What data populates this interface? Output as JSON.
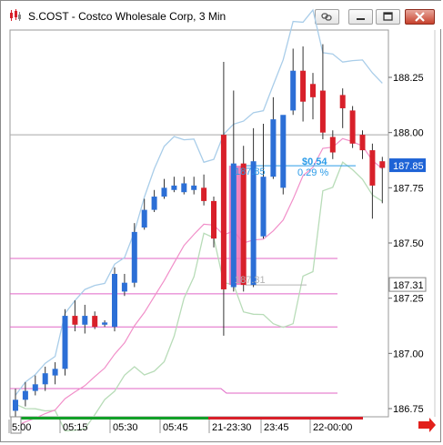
{
  "window": {
    "title": "S.COST - Costco Wholesale Corp, 3 Min"
  },
  "icons": {
    "app": "candlestick-app-icon",
    "link": "chain-link-icon",
    "minimize": "minimize-icon",
    "maximize": "maximize-icon",
    "close": "close-icon",
    "scroll": "scroll-right-arrow-icon"
  },
  "colors": {
    "up_candle": "#2c6fd6",
    "down_candle": "#d8202a",
    "upper_band": "#a9cde9",
    "lower_band": "#b8dcb8",
    "pink_line": "#f18fc9",
    "magenta_level": "#e066c6",
    "highlight": "#ee6fb2",
    "measure_text": "#2a9be8",
    "last_price_bg": "#1e63d6",
    "arrow": "#e2201b"
  },
  "chart_data": {
    "type": "candlestick",
    "symbol": "S.COST",
    "interval": "3 Min",
    "y_ticks": [
      "188.25",
      "188.00",
      "187.75",
      "187.50",
      "187.25",
      "187.00",
      "186.75"
    ],
    "y_tick_values": [
      188.25,
      188.0,
      187.75,
      187.5,
      187.25,
      187.0,
      186.75
    ],
    "x_ticks": [
      "5:00",
      "05:15",
      "05:30",
      "05:45",
      "21-23:30",
      "23:45",
      "22-00:00"
    ],
    "ylim": [
      186.69,
      188.45
    ],
    "price_labels": [
      {
        "text": "187.85",
        "value": 187.85,
        "style": "last"
      },
      {
        "text": "187.31",
        "value": 187.31,
        "style": "mark"
      }
    ],
    "measure": {
      "start_price": "187.31",
      "end_price": "187.85",
      "change": "$0.54",
      "pct": "0.29 %"
    },
    "reference_line": 187.99,
    "horizontal_levels": [
      187.43,
      187.27,
      187.12,
      186.82
    ],
    "candles": [
      {
        "o": 186.74,
        "h": 186.84,
        "l": 186.69,
        "c": 186.79
      },
      {
        "o": 186.79,
        "h": 186.87,
        "l": 186.76,
        "c": 186.83
      },
      {
        "o": 186.83,
        "h": 186.9,
        "l": 186.81,
        "c": 186.86
      },
      {
        "o": 186.86,
        "h": 186.94,
        "l": 186.83,
        "c": 186.91
      },
      {
        "o": 186.9,
        "h": 186.96,
        "l": 186.86,
        "c": 186.93
      },
      {
        "o": 186.93,
        "h": 187.2,
        "l": 186.9,
        "c": 187.17
      },
      {
        "o": 187.17,
        "h": 187.24,
        "l": 187.1,
        "c": 187.13
      },
      {
        "o": 187.13,
        "h": 187.22,
        "l": 187.09,
        "c": 187.17
      },
      {
        "o": 187.17,
        "h": 187.19,
        "l": 187.11,
        "c": 187.12
      },
      {
        "o": 187.13,
        "h": 187.15,
        "l": 187.12,
        "c": 187.14
      },
      {
        "o": 187.12,
        "h": 187.39,
        "l": 187.1,
        "c": 187.36
      },
      {
        "o": 187.28,
        "h": 187.36,
        "l": 187.26,
        "c": 187.32
      },
      {
        "o": 187.32,
        "h": 187.59,
        "l": 187.3,
        "c": 187.55
      },
      {
        "o": 187.57,
        "h": 187.7,
        "l": 187.56,
        "c": 187.65
      },
      {
        "o": 187.65,
        "h": 187.74,
        "l": 187.64,
        "c": 187.71
      },
      {
        "o": 187.71,
        "h": 187.79,
        "l": 187.7,
        "c": 187.75
      },
      {
        "o": 187.74,
        "h": 187.8,
        "l": 187.73,
        "c": 187.76
      },
      {
        "o": 187.73,
        "h": 187.8,
        "l": 187.72,
        "c": 187.77
      },
      {
        "o": 187.74,
        "h": 187.8,
        "l": 187.72,
        "c": 187.76
      },
      {
        "o": 187.75,
        "h": 187.81,
        "l": 187.67,
        "c": 187.69
      },
      {
        "o": 187.69,
        "h": 187.71,
        "l": 187.48,
        "c": 187.52
      },
      {
        "o": 187.99,
        "h": 188.32,
        "l": 187.08,
        "c": 187.29
      },
      {
        "o": 187.3,
        "h": 188.19,
        "l": 187.28,
        "c": 187.86
      },
      {
        "o": 187.86,
        "h": 187.94,
        "l": 187.28,
        "c": 187.31
      },
      {
        "o": 187.31,
        "h": 188.02,
        "l": 187.3,
        "c": 187.87
      },
      {
        "o": 187.53,
        "h": 188.04,
        "l": 187.52,
        "c": 187.8
      },
      {
        "o": 187.8,
        "h": 188.16,
        "l": 187.79,
        "c": 188.06
      },
      {
        "o": 187.75,
        "h": 188.04,
        "l": 187.72,
        "c": 188.08
      },
      {
        "o": 188.1,
        "h": 188.38,
        "l": 188.08,
        "c": 188.28
      },
      {
        "o": 188.28,
        "h": 188.39,
        "l": 188.05,
        "c": 188.14
      },
      {
        "o": 188.22,
        "h": 188.27,
        "l": 188.06,
        "c": 188.16
      },
      {
        "o": 188.19,
        "h": 188.4,
        "l": 187.97,
        "c": 188.0
      },
      {
        "o": 187.98,
        "h": 188.01,
        "l": 187.88,
        "c": 187.91
      },
      {
        "o": 188.17,
        "h": 188.2,
        "l": 188.02,
        "c": 188.11
      },
      {
        "o": 188.1,
        "h": 188.12,
        "l": 187.93,
        "c": 187.95
      },
      {
        "o": 187.99,
        "h": 188.01,
        "l": 187.88,
        "c": 187.92
      },
      {
        "o": 187.92,
        "h": 187.95,
        "l": 187.61,
        "c": 187.76
      },
      {
        "o": 187.87,
        "h": 187.89,
        "l": 187.68,
        "c": 187.84
      }
    ]
  }
}
